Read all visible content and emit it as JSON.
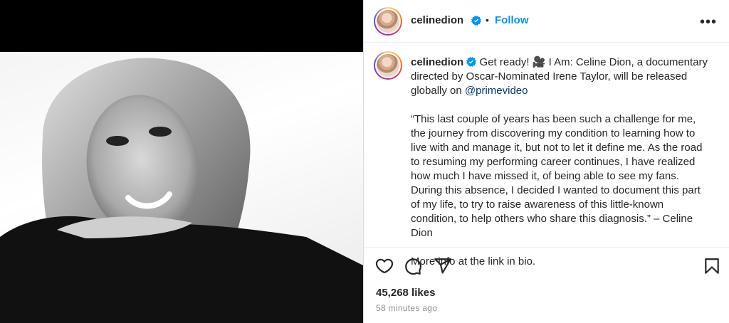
{
  "post": {
    "username": "celinedion",
    "separator": "•",
    "follow_label": "Follow",
    "more_label": "•••",
    "caption": {
      "username": "celinedion",
      "line1_lead": "Get ready! ",
      "emoji": "🎥",
      "line1_rest": " I Am: Celine Dion, a documentary directed by Oscar-Nominated Irene Taylor, will be released globally on ",
      "mention": "@primevideo",
      "quote": "“This last couple of years has been such a challenge for me, the journey from discovering my condition to learning how to live with and manage it, but not to let it define me. As the road to resuming my performing career continues, I have realized how much I have missed it, of being able to see my fans. During this absence, I decided I wanted to document this part of my life, to try to raise awareness of this little-known condition, to help others who share this diagnosis.” – Celine Dion",
      "more_info": "More info at the link in bio."
    },
    "likes": "45,268 likes",
    "timestamp": "58 minutes ago"
  },
  "icons": {
    "like": "heart-icon",
    "comment": "comment-icon",
    "share": "send-icon",
    "save": "bookmark-icon",
    "verified": "verified-badge-icon"
  },
  "colors": {
    "follow": "#0095f6",
    "verified": "#0095f6",
    "mention": "#00376b",
    "muted": "#8e8e8e"
  }
}
